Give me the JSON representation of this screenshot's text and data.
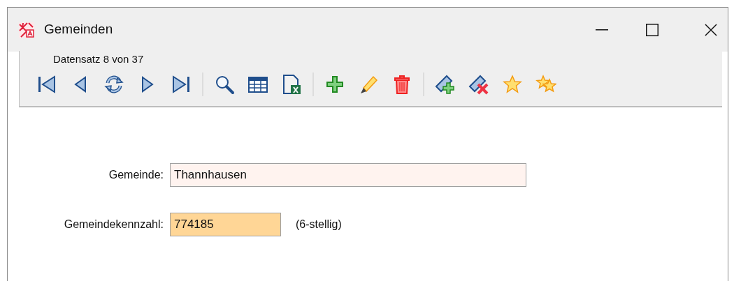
{
  "window": {
    "title": "Gemeinden"
  },
  "record_status": "Datensatz 8 von 37",
  "fields": [
    {
      "label": "Gemeinde:",
      "value": "Thannhausen",
      "kind": "wide"
    },
    {
      "label": "Gemeindekennzahl:",
      "value": "774185",
      "kind": "short",
      "hint": "(6-stellig)"
    }
  ]
}
